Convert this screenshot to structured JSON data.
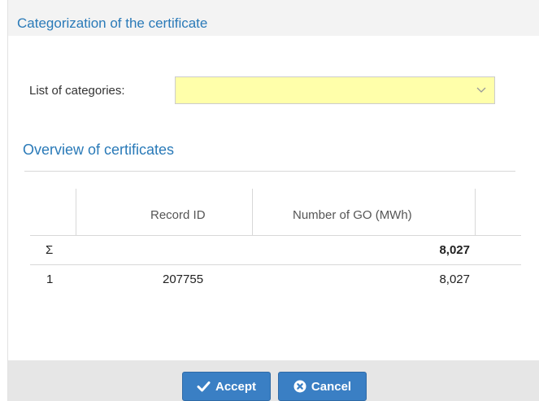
{
  "dialog": {
    "title": "Categorization of the certificate"
  },
  "categories_field": {
    "label": "List of categories:",
    "value": "",
    "background_color": "#ffffaa"
  },
  "overview": {
    "title": "Overview of certificates",
    "columns": [
      "",
      "Record ID",
      "Number of GO (MWh)"
    ],
    "sum_row": {
      "symbol": "Σ",
      "record_id": "",
      "number": "8,027"
    },
    "rows": [
      {
        "index": "1",
        "record_id": "207755",
        "number": "8,027"
      }
    ]
  },
  "buttons": {
    "accept_label": "Accept",
    "accept_icon": "checkmark-icon",
    "cancel_label": "Cancel",
    "cancel_icon": "close-circle-icon",
    "color": "#3a7fc4"
  },
  "colors": {
    "title_blue": "#2a7ab8"
  }
}
